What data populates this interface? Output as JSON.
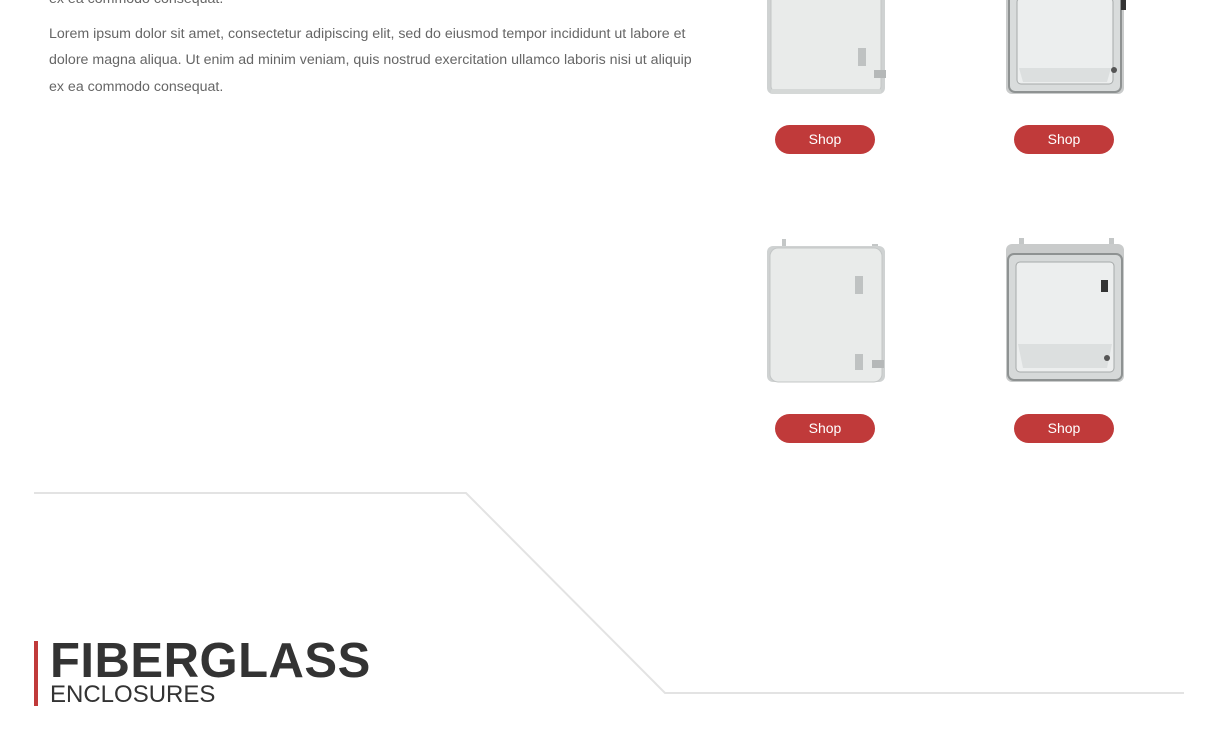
{
  "intro": {
    "paragraph_1_tail": "ex ea commodo consequat.",
    "paragraph_2": "Lorem ipsum dolor sit amet, consectetur adipiscing elit, sed do eiusmod tempor incididunt ut labore et dolore magna aliqua. Ut enim ad minim veniam, quis nostrud exercitation ullamco laboris nisi ut aliquip ex ea commodo consequat."
  },
  "products": [
    {
      "variant": "solid-cover",
      "shop_label": "Shop"
    },
    {
      "variant": "clear-cover",
      "shop_label": "Shop"
    },
    {
      "variant": "solid-cover",
      "shop_label": "Shop"
    },
    {
      "variant": "clear-cover",
      "shop_label": "Shop"
    }
  ],
  "section": {
    "title": "FIBERGLASS",
    "subtitle": "ENCLOSURES"
  },
  "colors": {
    "accent": "#c03a3a",
    "text": "#666666",
    "heading": "#333333",
    "divider": "#e3e3e3"
  }
}
